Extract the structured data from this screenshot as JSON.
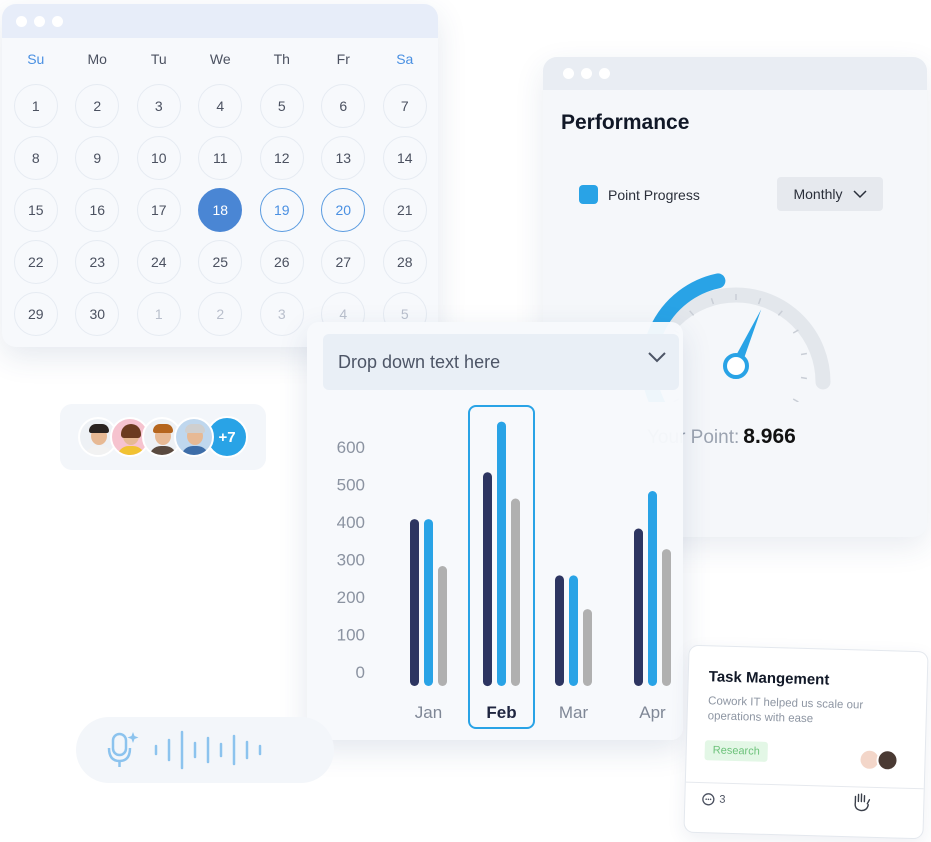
{
  "calendar": {
    "weekdays": [
      "Su",
      "Mo",
      "Tu",
      "We",
      "Th",
      "Fr",
      "Sa"
    ],
    "weeks": [
      [
        "1",
        "2",
        "3",
        "4",
        "5",
        "6",
        "7"
      ],
      [
        "8",
        "9",
        "10",
        "11",
        "12",
        "13",
        "14"
      ],
      [
        "15",
        "16",
        "17",
        "18",
        "19",
        "20",
        "21"
      ],
      [
        "22",
        "23",
        "24",
        "25",
        "26",
        "27",
        "28"
      ],
      [
        "29",
        "30",
        "1",
        "2",
        "3",
        "4",
        "5"
      ]
    ],
    "selected_day": "18",
    "highlighted_days": [
      "19",
      "20"
    ],
    "next_month_days_start_index": 2,
    "colors": {
      "selected": "#4a86d4",
      "weekend": "#4a90e2"
    }
  },
  "team": {
    "extra_count": "+7",
    "members": [
      "avatar-1",
      "avatar-2",
      "avatar-3",
      "avatar-4"
    ]
  },
  "performance": {
    "title": "Performance",
    "legend_label": "Point Progress",
    "period_select": "Monthly",
    "gauge_fill_fraction": 0.45,
    "your_point_label": "Your Point:",
    "your_point_value": "8.966",
    "accent_color": "#29a3e6"
  },
  "chart_panel": {
    "dropdown_placeholder": "Drop down text here",
    "chart_data": {
      "type": "bar",
      "categories": [
        "Jan",
        "Feb",
        "Mar",
        "Apr"
      ],
      "highlighted_category": "Feb",
      "ylim": [
        0,
        600
      ],
      "yticks": [
        "0",
        "100",
        "200",
        "300",
        "400",
        "500",
        "600"
      ],
      "series": [
        {
          "color": "#2d3561",
          "values": [
            445,
            570,
            295,
            420
          ]
        },
        {
          "color": "#29a3e6",
          "values": [
            445,
            705,
            295,
            520
          ]
        },
        {
          "color": "#b0b0b0",
          "values": [
            320,
            500,
            205,
            365
          ]
        }
      ]
    }
  },
  "voice": {
    "icon": "mic-sparkle-icon"
  },
  "task_card": {
    "title": "Task Mangement",
    "description": "Cowork IT helped us scale our operations with ease",
    "tag": "Research",
    "comment_count": "3",
    "icons": [
      "comment-icon",
      "hand-icon"
    ]
  }
}
